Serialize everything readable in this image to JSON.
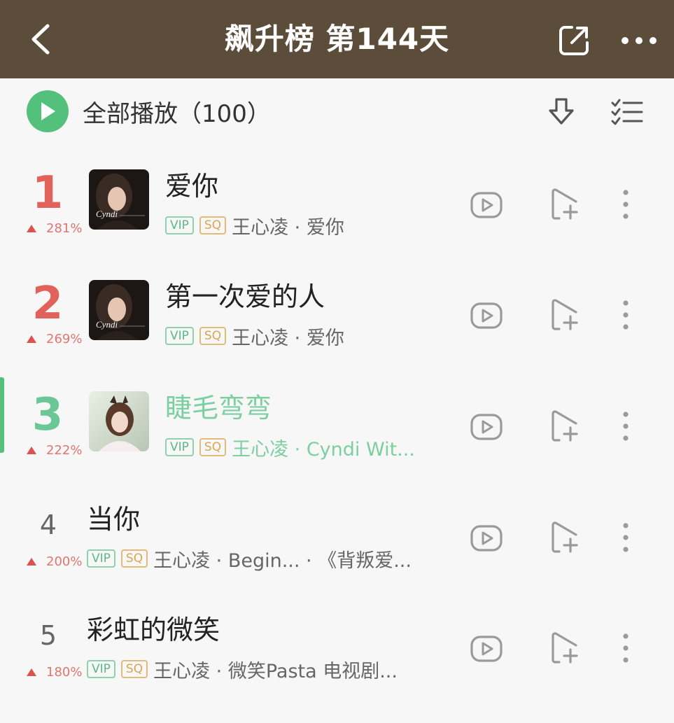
{
  "header": {
    "title": "飙升榜 第144天",
    "background": "#5b4d39",
    "back_icon": "chevron-left-icon",
    "share_icon": "share-external-icon",
    "more_icon": "more-horizontal-icon"
  },
  "play_all": {
    "label": "全部播放（100）",
    "accent": "#53c07c",
    "download_icon": "download-icon",
    "multi_select_icon": "multi-select-list-icon"
  },
  "songs": [
    {
      "rank": "1",
      "change": "281%",
      "title": "爱你",
      "vip": "VIP",
      "sq": "SQ",
      "meta": "王心凌 · 爱你",
      "rank_color": "#e0625a",
      "active": false
    },
    {
      "rank": "2",
      "change": "269%",
      "title": "第一次爱的人",
      "vip": "VIP",
      "sq": "SQ",
      "meta": "王心凌 · 爱你",
      "rank_color": "#e0625a",
      "active": false
    },
    {
      "rank": "3",
      "change": "222%",
      "title": "睫毛弯弯",
      "vip": "VIP",
      "sq": "SQ",
      "meta": "王心凌 · Cyndi Wit...",
      "rank_color": "#6cc796",
      "active": true
    },
    {
      "rank": "4",
      "change": "200%",
      "title": "当你",
      "vip": "VIP",
      "sq": "SQ",
      "meta": "王心凌 · Begin... · 《背叛爱...",
      "rank_color": "#666666",
      "active": false
    },
    {
      "rank": "5",
      "change": "180%",
      "title": "彩虹的微笑",
      "vip": "VIP",
      "sq": "SQ",
      "meta": "王心凌 · 微笑Pasta 电视剧...",
      "rank_color": "#666666",
      "active": false
    }
  ],
  "row_icons": {
    "mv": "mv-play-icon",
    "add": "add-to-playlist-icon",
    "more": "more-vertical-icon"
  }
}
